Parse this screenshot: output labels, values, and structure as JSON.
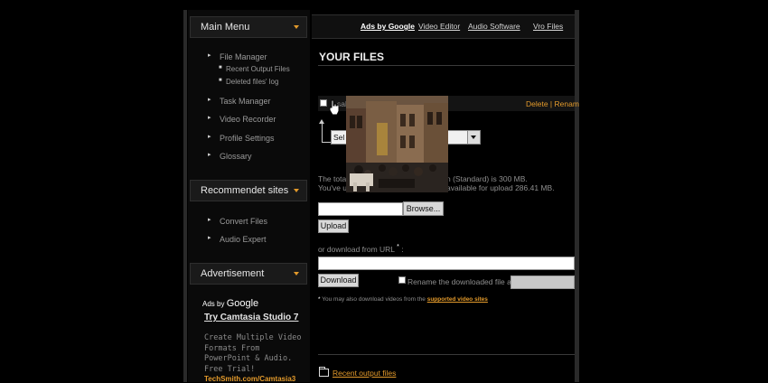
{
  "sidebar": {
    "main_menu_title": "Main Menu",
    "items": [
      {
        "label": "File Manager",
        "sub": [
          "Recent Output Files",
          "Deleted files' log"
        ]
      },
      {
        "label": "Task Manager"
      },
      {
        "label": "Video Recorder"
      },
      {
        "label": "Profile Settings"
      },
      {
        "label": "Glossary"
      }
    ],
    "recommended_title": "Recommendet sites",
    "recommended": [
      "Convert Files",
      "Audio Expert"
    ],
    "ad_title": "Advertisement",
    "ad": {
      "ads_by": "Ads by",
      "google": "Google",
      "title": "Try Camtasia Studio 7",
      "text": "Create Multiple Video Formats From PowerPoint & Audio. Free Trial!",
      "url": "TechSmith.com/Camtasia3"
    }
  },
  "topnav": {
    "ads_by_google": "Ads by Google",
    "links": [
      "Video Editor",
      "Audio Software",
      "Vro Files"
    ]
  },
  "main": {
    "title": "YOUR FILES",
    "file_row_fragment": "sal",
    "actions": "Delete | Renam",
    "select_value": "Sel",
    "quota_line1_start": "The total",
    "quota_line1_end": "n (Standard) is 300 MB.",
    "quota_line2_start": "You've u",
    "quota_line2_end": "available for upload 286.41 MB.",
    "browse_label": "Browse...",
    "upload_label": "Upload",
    "url_label": "or download from URL",
    "url_marker": "*",
    "url_colon": ":",
    "download_label": "Download",
    "rename_label": "Rename the downloaded file as",
    "footnote_marker": "*",
    "footnote_text": "You may also download videos from the",
    "footnote_link": "supported video sites",
    "recent_output": "Recent output files"
  }
}
